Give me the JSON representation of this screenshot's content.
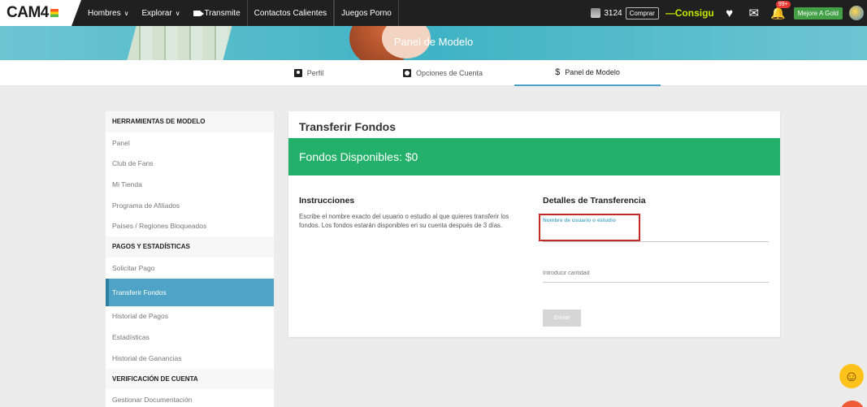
{
  "nav": {
    "logo": "CAM4",
    "items": [
      {
        "label": "Hombres",
        "has_dropdown": true
      },
      {
        "label": "Explorar",
        "has_dropdown": true
      },
      {
        "label": "Transmite",
        "has_dropdown": false
      },
      {
        "label": "Contactos Calientes",
        "has_dropdown": false
      },
      {
        "label": "Juegos Porno",
        "has_dropdown": false
      }
    ],
    "tokens": "3124",
    "buy_label": "Comprar",
    "consign_label": "—Consigu",
    "notification_count": "99+",
    "gold_label": "Mejore A Gold"
  },
  "banner": {
    "title": "Panel de Modelo"
  },
  "tabs": [
    {
      "label": "Perfil",
      "icon": "user-icon"
    },
    {
      "label": "Opciones de Cuenta",
      "icon": "settings-icon"
    },
    {
      "label": "Panel de Modelo",
      "icon": "dollar-icon",
      "active": true
    }
  ],
  "sidebar": {
    "items": [
      {
        "label": "HERRAMIENTAS DE MODELO",
        "type": "header"
      },
      {
        "label": "Panel",
        "type": "link"
      },
      {
        "label": "Club de Fans",
        "type": "link"
      },
      {
        "label": "Mi Tienda",
        "type": "link"
      },
      {
        "label": "Programa de Afiliados",
        "type": "link"
      },
      {
        "label": "Países / Regiones Bloqueados",
        "type": "link"
      },
      {
        "label": "PAGOS Y ESTADÍSTICAS",
        "type": "header"
      },
      {
        "label": "Solicitar Pago",
        "type": "link"
      },
      {
        "label": "Transferir Fondos",
        "type": "active"
      },
      {
        "label": "Historial de Pagos",
        "type": "link"
      },
      {
        "label": "Estadísticas",
        "type": "link"
      },
      {
        "label": "Historial de Ganancias",
        "type": "link"
      },
      {
        "label": "VERIFICACIÓN DE CUENTA",
        "type": "header"
      },
      {
        "label": "Gestionar Documentación",
        "type": "link"
      }
    ]
  },
  "main": {
    "title": "Transferir Fondos",
    "funds": "Fondos Disponibles: $0",
    "instructions_title": "Instrucciones",
    "instructions_text": "Escribe el nombre exacto del usuario o estudio al que quieres transferir los fondos. Los fondos estarán disponibles en su cuenta después de 3 días.",
    "details_title": "Detalles de Transferencia",
    "username_label": "Nombre de usuario o estudio",
    "amount_placeholder": "Introducir cantidad",
    "send_label": "Enviar"
  },
  "colors": {
    "accent": "#4fa3c7",
    "funds_green": "#23b06a",
    "highlight_red": "#c62828"
  }
}
